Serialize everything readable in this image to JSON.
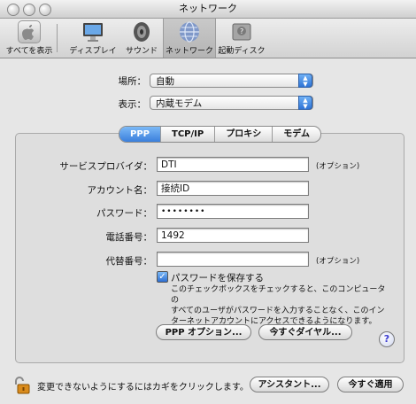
{
  "window": {
    "title": "ネットワーク"
  },
  "toolbar": {
    "items": [
      {
        "label": "すべてを表示",
        "icon": "apple-grid-icon"
      },
      {
        "label": "ディスプレイ",
        "icon": "display-icon"
      },
      {
        "label": "サウンド",
        "icon": "speaker-icon"
      },
      {
        "label": "ネットワーク",
        "icon": "globe-icon"
      },
      {
        "label": "起動ディスク",
        "icon": "hard-disk-icon"
      }
    ],
    "selected": "ネットワーク"
  },
  "location": {
    "label": "場所：",
    "value": "自動"
  },
  "show": {
    "label": "表示：",
    "value": "内蔵モデム"
  },
  "tabs": [
    "PPP",
    "TCP/IP",
    "プロキシ",
    "モデム"
  ],
  "active_tab": "PPP",
  "form": {
    "service_provider": {
      "label": "サービスプロバイダ：",
      "value": "DTI",
      "note": "(オプション)"
    },
    "account_name": {
      "label": "アカウント名：",
      "value": "接続ID"
    },
    "password": {
      "label": "パスワード：",
      "value": "••••••••"
    },
    "phone": {
      "label": "電話番号：",
      "value": "1492"
    },
    "alt_phone": {
      "label": "代替番号：",
      "value": "",
      "note": "(オプション)"
    }
  },
  "save_password": {
    "checked": true,
    "label": "パスワードを保存する",
    "description_lines": [
      "このチェックボックスをチェックすると、このコンピュータの",
      "すべてのユーザがパスワードを入力することなく、このイン",
      "ターネットアカウントにアクセスできるようになります。"
    ]
  },
  "buttons": {
    "ppp_options": "PPP オプション...",
    "dial_now": "今すぐダイヤル...",
    "assistant": "アシスタント...",
    "apply_now": "今すぐ適用",
    "help": "?"
  },
  "lock_text": "変更できないようにするにはカギをクリックします。",
  "colors": {
    "accent": "#3a7fdc",
    "lock": "#d98b1c"
  }
}
